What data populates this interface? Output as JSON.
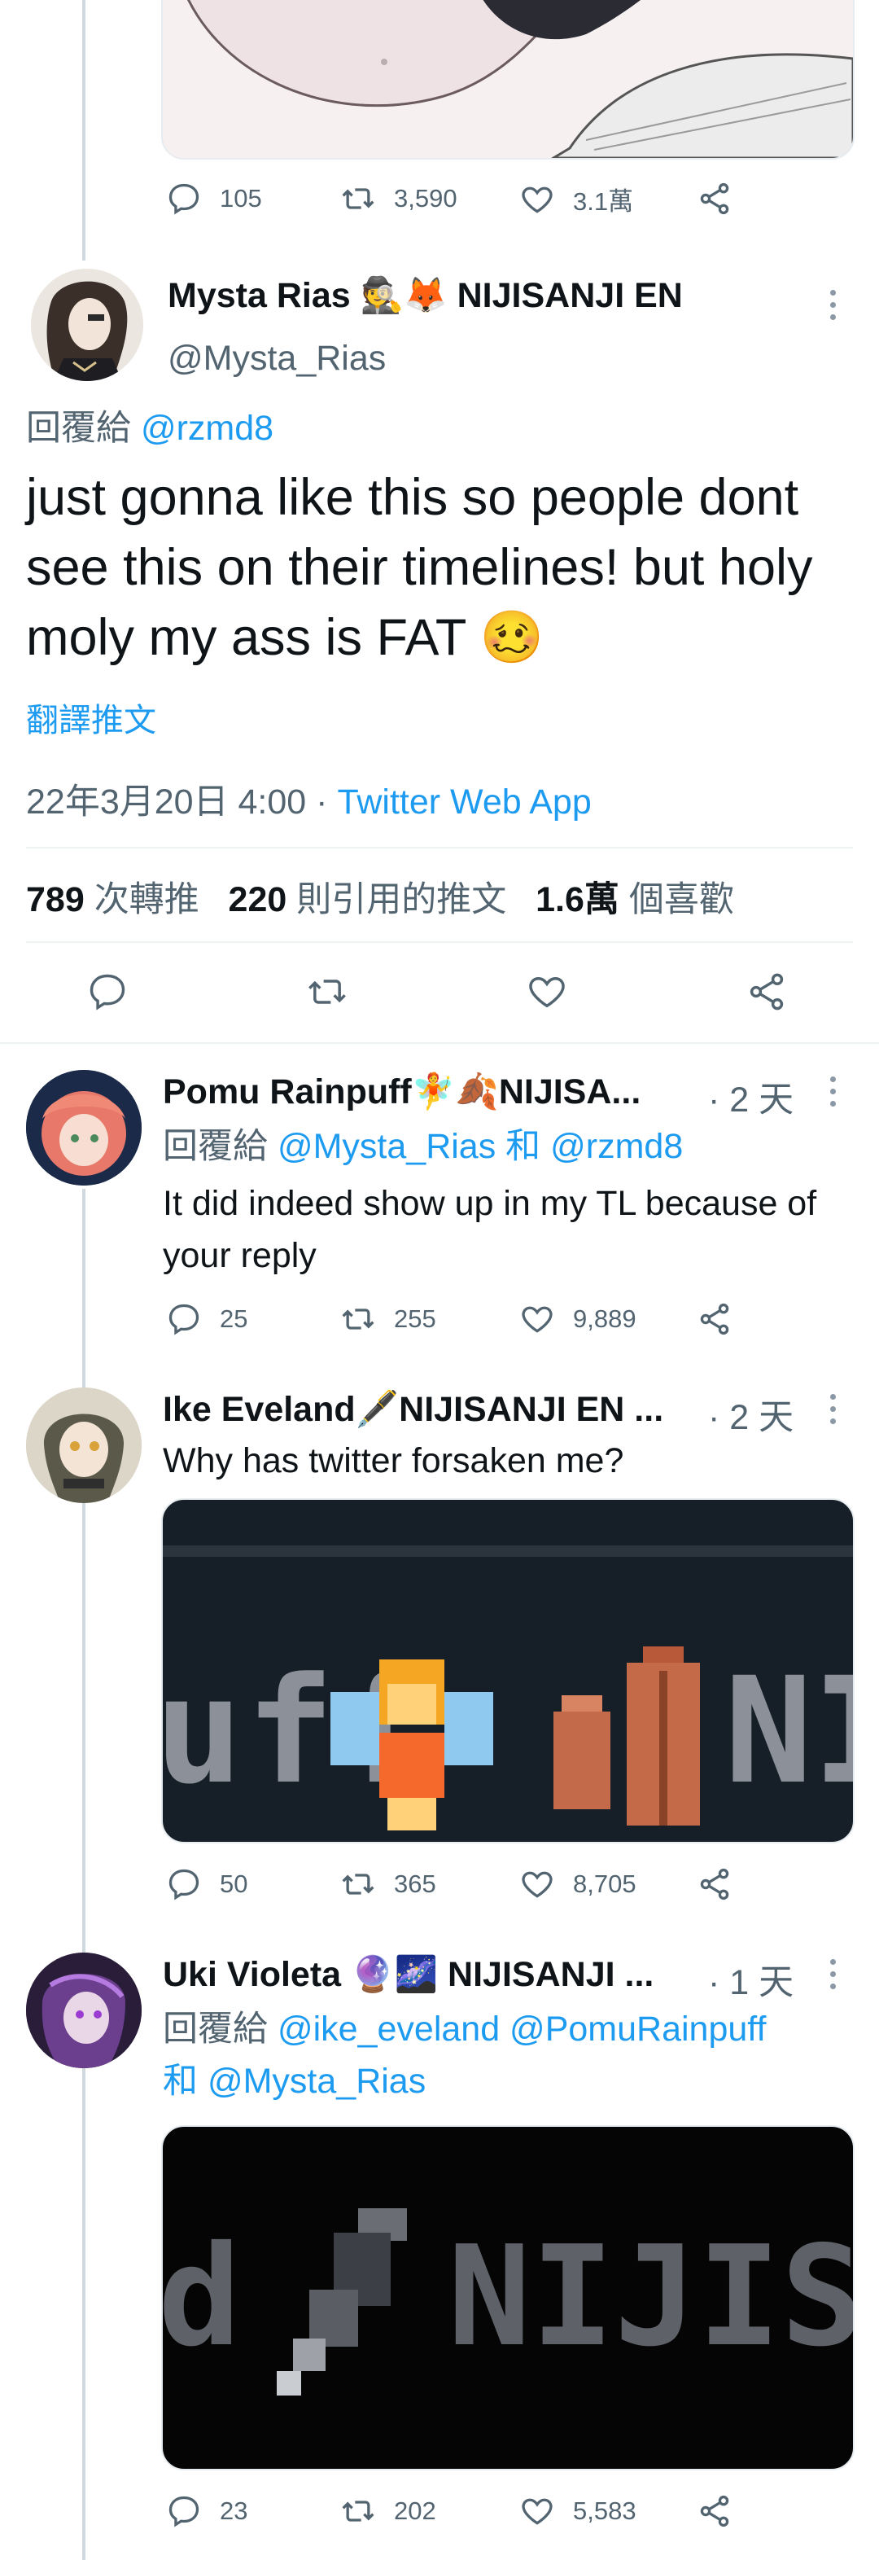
{
  "top_tweet": {
    "counts": {
      "replies": "105",
      "retweets": "3,590",
      "likes": "3.1萬"
    }
  },
  "main_tweet": {
    "display_name": "Mysta Rias 🕵️🦊 NIJISANJI EN",
    "handle": "@Mysta_Rias",
    "reply_prefix": "回覆給",
    "reply_to": "@rzmd8",
    "text": "just gonna like this so people dont see this on their timelines! but holy moly my ass is FAT 🥴",
    "translate_label": "翻譯推文",
    "timestamp": "22年3月20日 4:00",
    "separator": " · ",
    "source": "Twitter Web App",
    "stats": {
      "retweets_num": "789",
      "retweets_label": "次轉推",
      "quotes_num": "220",
      "quotes_label": "則引用的推文",
      "likes_num": "1.6萬",
      "likes_label": "個喜歡"
    }
  },
  "replies": [
    {
      "display_name": "Pomu Rainpuff🧚🍂NIJISA...",
      "time": "· 2 天",
      "reply_prefix": "回覆給",
      "reply_line": "@Mysta_Rias 和 @rzmd8",
      "text": "It did indeed show up in my TL because of your reply",
      "counts": {
        "replies": "25",
        "retweets": "255",
        "likes": "9,889"
      }
    },
    {
      "display_name": "Ike Eveland🖋️NIJISANJI EN ...",
      "time": "· 2 天",
      "text": "Why has twitter forsaken me?",
      "media_text": "uff",
      "media_text_right": "NI",
      "counts": {
        "replies": "50",
        "retweets": "365",
        "likes": "8,705"
      }
    },
    {
      "display_name": "Uki Violeta 🔮🌌 NIJISANJI ...",
      "time": "· 1 天",
      "reply_prefix": "回覆給",
      "reply_line1": "@ike_eveland @PomuRainpuff",
      "reply_line2_and": "和",
      "reply_line2": "@Mysta_Rias",
      "media_text_left": "d",
      "media_text": "NIJISA",
      "counts": {
        "replies": "23",
        "retweets": "202",
        "likes": "5,583"
      }
    }
  ],
  "colors": {
    "accent": "#1d9bf0",
    "muted": "#536471",
    "divider": "#eff3f4",
    "thread": "#cfd9de"
  }
}
